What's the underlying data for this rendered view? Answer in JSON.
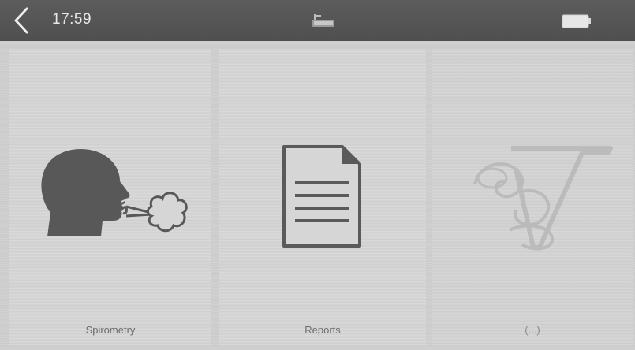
{
  "status_bar": {
    "time": "17:59",
    "back_icon": "chevron-left-icon",
    "center_icon": "connection-icon",
    "battery_icon": "battery-icon"
  },
  "tiles": [
    {
      "label": "Spirometry",
      "icon": "breathing-head-icon"
    },
    {
      "label": "Reports",
      "icon": "document-icon"
    },
    {
      "label": "(...)",
      "icon": "logo-icon"
    }
  ],
  "colors": {
    "topbar": "#555555",
    "tile_bg": "#d6d6d6",
    "icon_dark": "#555555",
    "icon_faded": "#b5b5b5"
  }
}
